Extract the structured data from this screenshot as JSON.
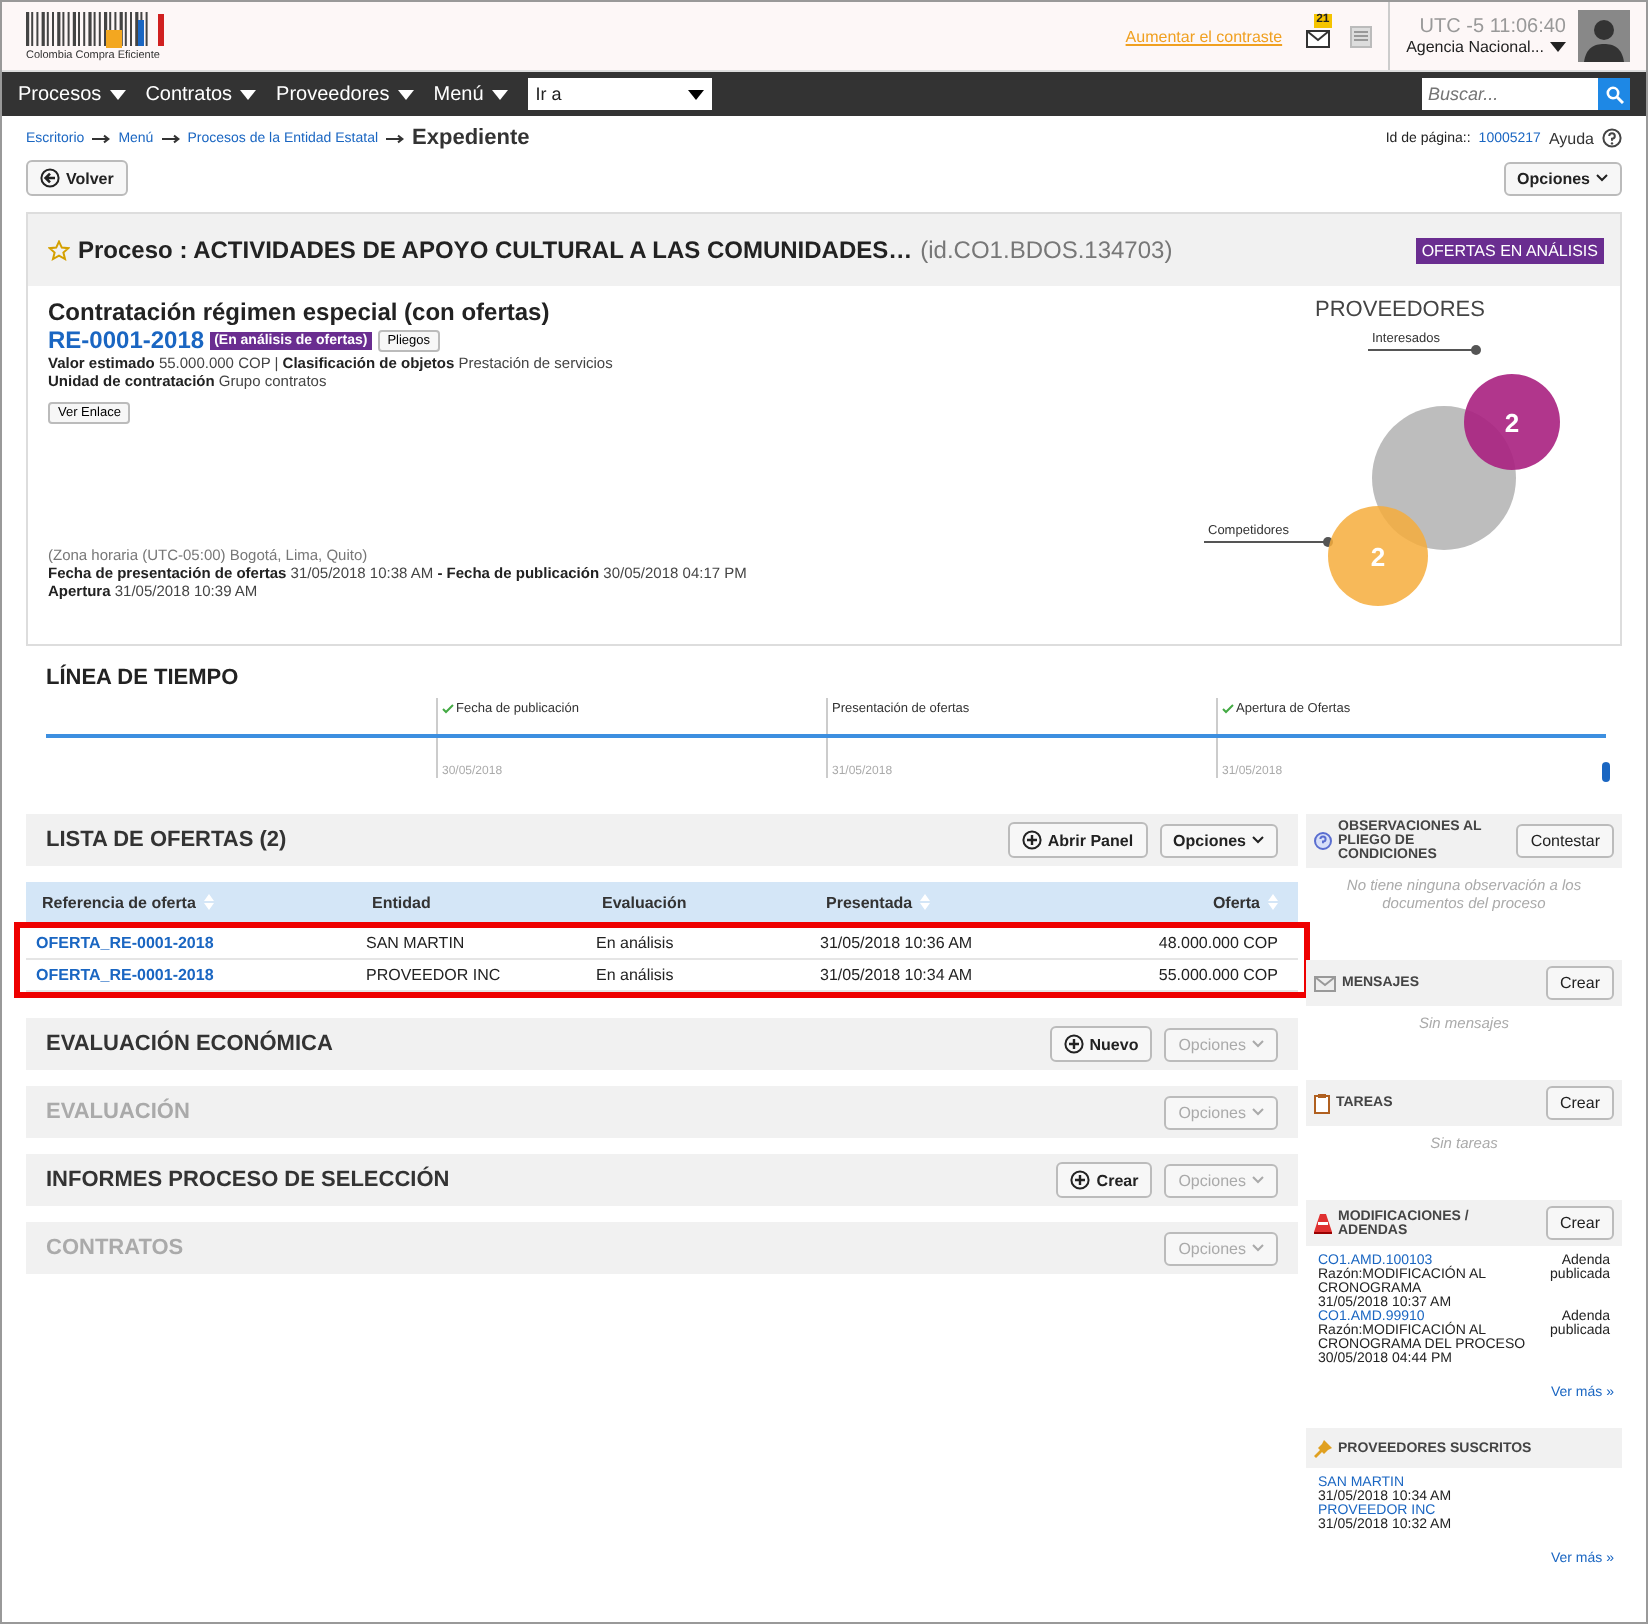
{
  "header": {
    "logo_text": "Colombia Compra Eficiente",
    "contrast_link": "Aumentar el contraste",
    "mail_count": "21",
    "timezone": "UTC -5",
    "time": "11:06:40",
    "agency": "Agencia Nacional..."
  },
  "nav": {
    "items": [
      "Procesos",
      "Contratos",
      "Proveedores",
      "Menú"
    ],
    "goto": "Ir a",
    "search_placeholder": "Buscar..."
  },
  "breadcrumb": {
    "links": [
      "Escritorio",
      "Menú",
      "Procesos de la Entidad Estatal"
    ],
    "current": "Expediente",
    "page_id_label": "Id de página::",
    "page_id": "10005217",
    "help": "Ayuda"
  },
  "back_button": "Volver",
  "options_button": "Opciones",
  "process": {
    "title": "Proceso : ACTIVIDADES DE APOYO CULTURAL A LAS COMUNIDADES…",
    "id": "(id.CO1.BDOS.134703)",
    "status": "OFERTAS EN ANÁLISIS",
    "type": "Contratación régimen especial (con ofertas)",
    "reference": "RE-0001-2018",
    "reference_status": "(En análisis de ofertas)",
    "pliegos_button": "Pliegos",
    "details": [
      "**Valor estimado** 55.000.000 COP | **Clasificación de objetos**  Prestación de servicios",
      "**Unidad de contratación** Grupo contratos"
    ],
    "link_button": "Ver Enlace",
    "timezone_note": "(Zona horaria (UTC-05:00) Bogotá, Lima, Quito)",
    "dates": [
      "**Fecha de presentación de ofertas** 31/05/2018 10:38 AM **- Fecha de publicación** 30/05/2018 04:17 PM",
      "**Apertura** 31/05/2018 10:39 AM"
    ]
  },
  "suppliers": {
    "title": "PROVEEDORES",
    "interested_label": "Interesados",
    "interested_count": "2",
    "competitors_label": "Competidores",
    "competitors_count": "2"
  },
  "timeline": {
    "title": "LÍNEA DE TIEMPO",
    "steps": [
      {
        "label": "Fecha de publicación",
        "date": "30/05/2018",
        "done": true
      },
      {
        "label": "Presentación de ofertas",
        "date": "31/05/2018",
        "done": false
      },
      {
        "label": "Apertura de Ofertas",
        "date": "31/05/2018",
        "done": true
      }
    ]
  },
  "offers": {
    "title": "LISTA DE OFERTAS (2)",
    "open_panel": "Abrir Panel",
    "options": "Opciones",
    "columns": [
      "Referencia de oferta",
      "Entidad",
      "Evaluación",
      "Presentada",
      "Oferta"
    ],
    "rows": [
      [
        "OFERTA_RE-0001-2018",
        "SAN MARTIN",
        "En análisis",
        "31/05/2018 10:36 AM",
        "48.000.000 COP"
      ],
      [
        "OFERTA_RE-0001-2018",
        "PROVEEDOR INC",
        "En análisis",
        "31/05/2018 10:34 AM",
        "55.000.000 COP"
      ]
    ]
  },
  "sections": [
    {
      "title": "EVALUACIÓN ECONÓMICA",
      "disabled": false,
      "action": "Nuevo",
      "options": "Opciones"
    },
    {
      "title": "EVALUACIÓN",
      "disabled": true,
      "options": "Opciones"
    },
    {
      "title": "INFORMES PROCESO DE SELECCIÓN",
      "disabled": false,
      "action": "Crear",
      "options": "Opciones"
    },
    {
      "title": "CONTRATOS",
      "disabled": true,
      "options": "Opciones"
    }
  ],
  "sidebar": [
    {
      "kind": "observations",
      "title": "OBSERVACIONES AL PLIEGO DE CONDICIONES",
      "button": "Contestar",
      "empty": "No tiene ninguna observación a los documentos del proceso"
    },
    {
      "kind": "messages",
      "title": "MENSAJES",
      "button": "Crear",
      "empty": "Sin mensajes"
    },
    {
      "kind": "tasks",
      "title": "TAREAS",
      "button": "Crear",
      "empty": "Sin tareas"
    },
    {
      "kind": "amendments",
      "title": "MODIFICACIONES / ADENDAS",
      "button": "Crear",
      "items": [
        {
          "link": "CO1.AMD.100103",
          "status": "Adenda publicada",
          "lines": [
            "Razón:MODIFICACIÓN AL CRONOGRAMA",
            "31/05/2018 10:37 AM"
          ]
        },
        {
          "link": "CO1.AMD.99910",
          "status": "Adenda publicada",
          "lines": [
            "Razón:MODIFICACIÓN AL CRONOGRAMA DEL PROCESO",
            "30/05/2018 04:44 PM"
          ]
        }
      ],
      "more": "Ver más »"
    },
    {
      "kind": "subscribers",
      "title": "PROVEEDORES SUSCRITOS",
      "items": [
        {
          "link": "SAN MARTIN",
          "lines": [
            "31/05/2018 10:34 AM"
          ]
        },
        {
          "link": "PROVEEDOR INC",
          "lines": [
            "31/05/2018 10:32 AM"
          ]
        }
      ],
      "more": "Ver más »"
    }
  ]
}
